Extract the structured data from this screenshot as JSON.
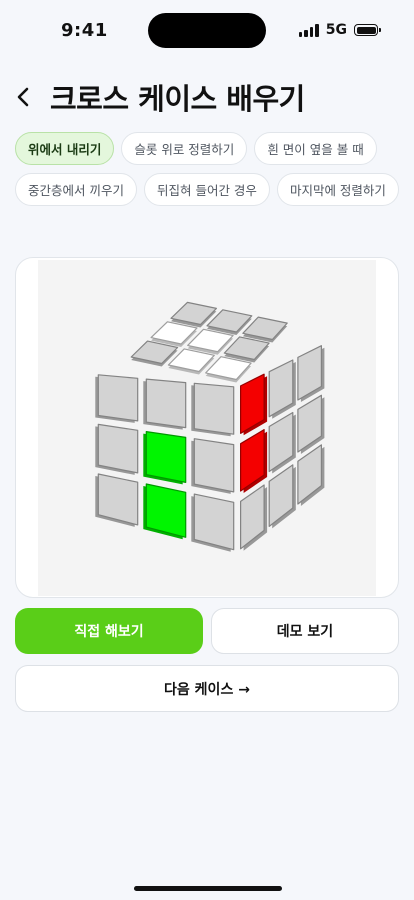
{
  "status": {
    "time": "9:41",
    "network": "5G",
    "icons": [
      "signal-icon",
      "battery-icon"
    ]
  },
  "header": {
    "back_icon": "chevron-left-icon",
    "title": "크로스 케이스 배우기"
  },
  "chips": [
    {
      "label": "위에서 내리기",
      "selected": true
    },
    {
      "label": "슬롯 위로 정렬하기",
      "selected": false
    },
    {
      "label": "흰 면이 옆을 볼 때",
      "selected": false
    },
    {
      "label": "중간층에서 끼우기",
      "selected": false
    },
    {
      "label": "뒤집혀 들어간 경우",
      "selected": false
    },
    {
      "label": "마지막에 정렬하기",
      "selected": false
    }
  ],
  "cube": {
    "colors": {
      "white": "#ffffff",
      "gray": "#d3d3d3",
      "green": "#00f500",
      "red": "#f40000"
    },
    "top": [
      [
        "gray",
        "gray",
        "gray"
      ],
      [
        "white",
        "white",
        "gray"
      ],
      [
        "gray",
        "white",
        "white"
      ]
    ],
    "left": [
      [
        "gray",
        "gray",
        "gray"
      ],
      [
        "gray",
        "green",
        "gray"
      ],
      [
        "gray",
        "green",
        "gray"
      ]
    ],
    "right": [
      [
        "red",
        "gray",
        "gray"
      ],
      [
        "red",
        "gray",
        "gray"
      ],
      [
        "gray",
        "gray",
        "gray"
      ]
    ]
  },
  "actions": {
    "try": "직접 해보기",
    "demo": "데모 보기",
    "next": "다음 케이스 →"
  },
  "theme": {
    "accent": "#5ace18",
    "selected_chip_bg": "#e4f7dc"
  }
}
